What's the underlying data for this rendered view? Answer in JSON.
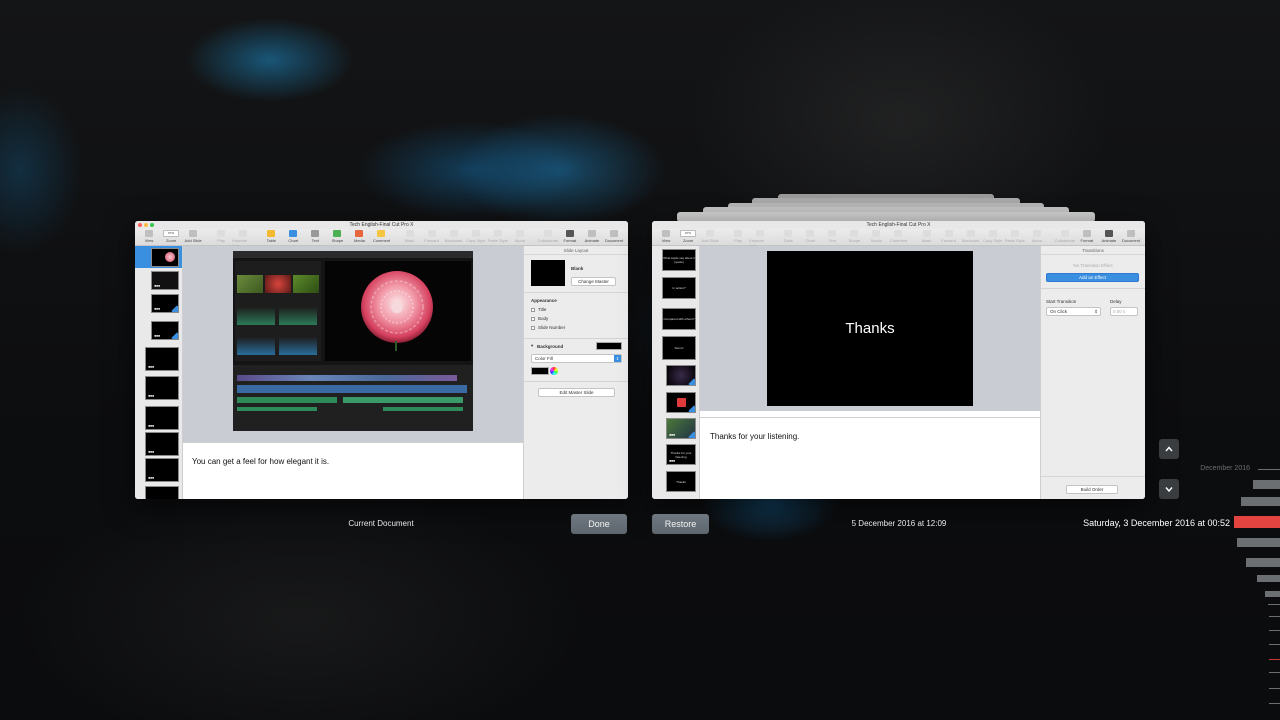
{
  "document_title": "Tech English-Final Cut Pro X",
  "toolbar": {
    "view": "View",
    "zoom": "Zoom",
    "zoom_value": "97%",
    "add_slide": "Add Slide",
    "play": "Play",
    "keynote_live": "Keynote Live",
    "table": "Table",
    "chart": "Chart",
    "text": "Text",
    "shape": "Shape",
    "media": "Media",
    "comment": "Comment",
    "mask": "Mask",
    "forward": "Forward",
    "backward": "Backward",
    "copy_style": "Copy Style",
    "paste_style": "Paste Style",
    "alpha": "Alpha",
    "collaborate": "Collaborate",
    "format": "Format",
    "animate": "Animate",
    "document": "Document"
  },
  "current_window": {
    "notes": "You can get a feel for how elegant it is.",
    "inspector": {
      "header": "Slide Layout",
      "master_name": "Blank",
      "change_master": "Change Master",
      "appearance": "Appearance",
      "title": "Title",
      "body": "Body",
      "slide_number": "Slide Number",
      "background": "Background",
      "fill_type": "Color Fill",
      "edit_master": "Edit Master Slide"
    }
  },
  "version_window": {
    "slide_text": "Thanks",
    "notes": "Thanks for your listening.",
    "inspector": {
      "header": "Transitions",
      "no_effect": "No Transition Effect",
      "add_effect": "Add an Effect",
      "start_transition": "Start Transition",
      "delay": "Delay",
      "start_value": "On Click",
      "delay_value": "0.00 s",
      "build_order": "Build Order"
    }
  },
  "thumbnails_right": [
    {
      "text": "What Apple say about it (quote)"
    },
    {
      "text": "In action?"
    },
    {
      "text": "Compared with others?"
    },
    {
      "text": "Demo!"
    },
    {
      "text": ""
    },
    {
      "text": ""
    },
    {
      "text": ""
    },
    {
      "text": "Thanks for your listening"
    },
    {
      "text": "Thanks"
    }
  ],
  "labels": {
    "current_document": "Current Document",
    "done": "Done",
    "restore": "Restore",
    "version_date": "5 December 2016 at 12:09",
    "timeline_selected": "Saturday, 3 December 2016 at 00:52",
    "timeline_month": "December 2016"
  }
}
